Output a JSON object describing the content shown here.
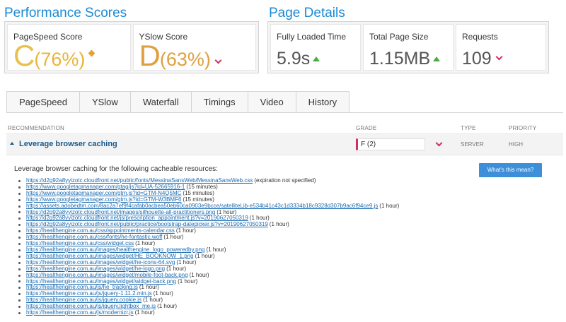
{
  "performance": {
    "title": "Performance Scores",
    "pagespeed": {
      "label": "PageSpeed Score",
      "grade": "C",
      "percent": "(76%)"
    },
    "yslow": {
      "label": "YSlow Score",
      "grade": "D",
      "percent": "(63%)"
    }
  },
  "details": {
    "title": "Page Details",
    "load_time": {
      "label": "Fully Loaded Time",
      "value": "5.9s"
    },
    "page_size": {
      "label": "Total Page Size",
      "value": "1.15MB"
    },
    "requests": {
      "label": "Requests",
      "value": "109"
    }
  },
  "tabs": [
    "PageSpeed",
    "YSlow",
    "Waterfall",
    "Timings",
    "Video",
    "History"
  ],
  "table": {
    "headers": {
      "recommendation": "RECOMMENDATION",
      "grade": "GRADE",
      "type": "TYPE",
      "priority": "PRIORITY"
    },
    "row": {
      "name": "Leverage browser caching",
      "grade": "F (2)",
      "type": "SERVER",
      "priority": "HIGH"
    }
  },
  "detail": {
    "intro": "Leverage browser caching for the following cacheable resources:",
    "button": "What's this mean?",
    "resources": [
      {
        "url": "https://d2g92a8yyizotc.cloudfront.net/public/fonts/MessinaSansWeb/MessinaSansWeb.css",
        "exp": "(expiration not specified)"
      },
      {
        "url": "https://www.googletagmanager.com/gtag/js?id=UA-52665916-1",
        "exp": "(15 minutes)"
      },
      {
        "url": "https://www.googletagmanager.com/gtm.js?id=GTM-N4Q5MC",
        "exp": "(15 minutes)"
      },
      {
        "url": "https://www.googletagmanager.com/gtm.js?id=GTM-W3BMF6",
        "exp": "(15 minutes)"
      },
      {
        "url": "https://assets.adobedtm.com/8ac2a7ef9f4cafab0acbea50eb60ca0903e9bcce/satelliteLib-e534b41c43c1d3334b18c9328d307b9ac6f94ce9.js",
        "exp": "(1 hour)"
      },
      {
        "url": "https://d2g92a8yyizotc.cloudfront.net/images/silhouette-all-practitioners.png",
        "exp": "(1 hour)"
      },
      {
        "url": "https://d2g92a8yyizotc.cloudfront.net/js/prescription_appointment.js?v=20190627050319",
        "exp": "(1 hour)"
      },
      {
        "url": "https://d2g92a8yyizotc.cloudfront.net/public/practice/bootstrap-datepicker.js?v=20190627050319",
        "exp": "(1 hour)"
      },
      {
        "url": "https://healthengine.com.au/css/appointments-calendar.css",
        "exp": "(1 hour)"
      },
      {
        "url": "https://healthengine.com.au/css/fonts/he-fontastic.woff",
        "exp": "(1 hour)"
      },
      {
        "url": "https://healthengine.com.au/css/widget.css",
        "exp": "(1 hour)"
      },
      {
        "url": "https://healthengine.com.au/images/healthengine_logo_poweredby.png",
        "exp": "(1 hour)"
      },
      {
        "url": "https://healthengine.com.au/images/widget/HE_BOOKNOW_1.png",
        "exp": "(1 hour)"
      },
      {
        "url": "https://healthengine.com.au/images/widget/he-icons-64.svg",
        "exp": "(1 hour)"
      },
      {
        "url": "https://healthengine.com.au/images/widget/he-logo.png",
        "exp": "(1 hour)"
      },
      {
        "url": "https://healthengine.com.au/images/widget/mobile-foot-back.png",
        "exp": "(1 hour)"
      },
      {
        "url": "https://healthengine.com.au/images/widget/widget-back.png",
        "exp": "(1 hour)"
      },
      {
        "url": "https://healthengine.com.au/js/he_tracking.js",
        "exp": "(1 hour)"
      },
      {
        "url": "https://healthengine.com.au/js/jquery-1.11.2.min.js",
        "exp": "(1 hour)"
      },
      {
        "url": "https://healthengine.com.au/js/jquery.cookie.js",
        "exp": "(1 hour)"
      },
      {
        "url": "https://healthengine.com.au/js/jquery.lightbox_me.js",
        "exp": "(1 hour)"
      },
      {
        "url": "https://healthengine.com.au/js/modernizr.js",
        "exp": "(1 hour)"
      }
    ]
  }
}
